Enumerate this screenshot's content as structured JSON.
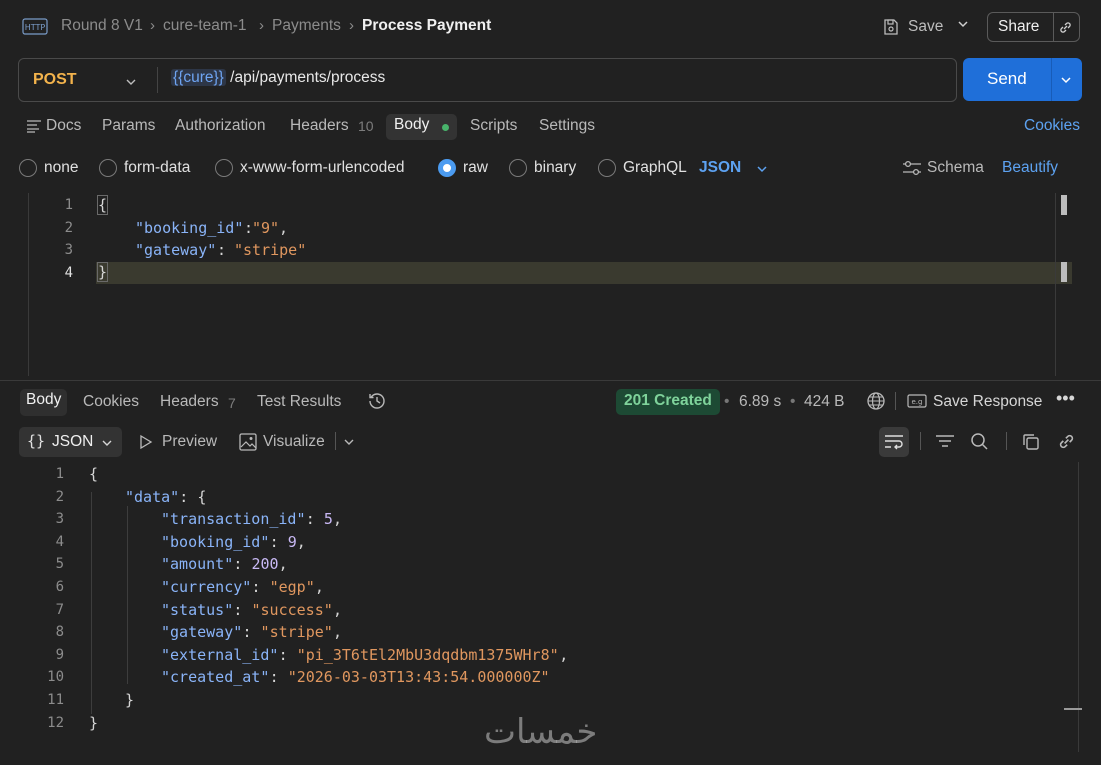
{
  "breadcrumb": {
    "items": [
      "Round 8 V1",
      "cure-team-1",
      "Payments"
    ],
    "current": "Process Payment"
  },
  "header": {
    "save_label": "Save",
    "share_label": "Share"
  },
  "request": {
    "method": "POST",
    "url_variable": "{{cure}}",
    "url_path": "/api/payments/process",
    "send_label": "Send"
  },
  "request_tabs": {
    "docs": "Docs",
    "params": "Params",
    "authorization": "Authorization",
    "headers": "Headers",
    "headers_count": "10",
    "body": "Body",
    "scripts": "Scripts",
    "settings": "Settings",
    "cookies": "Cookies"
  },
  "body_types": {
    "none": "none",
    "form_data": "form-data",
    "urlencoded": "x-www-form-urlencoded",
    "raw": "raw",
    "binary": "binary",
    "graphql": "GraphQL",
    "format": "JSON",
    "schema": "Schema",
    "beautify": "Beautify",
    "selected": "raw"
  },
  "request_body": {
    "line_numbers": [
      "1",
      "2",
      "3",
      "4"
    ],
    "open_brace": "{",
    "key1": "\"booking_id\"",
    "val1": "\"9\"",
    "key2": "\"gateway\"",
    "val2": "\"stripe\"",
    "close_brace": "}"
  },
  "response_tabs": {
    "body": "Body",
    "cookies": "Cookies",
    "headers": "Headers",
    "headers_count": "7",
    "test_results": "Test Results"
  },
  "response_status": {
    "status": "201 Created",
    "time": "6.89 s",
    "size": "424 B",
    "save_response": "Save Response"
  },
  "response_view": {
    "format": "JSON",
    "preview": "Preview",
    "visualize": "Visualize"
  },
  "response_body": {
    "line_numbers": [
      "1",
      "2",
      "3",
      "4",
      "5",
      "6",
      "7",
      "8",
      "9",
      "10",
      "11",
      "12"
    ],
    "open_brace": "{",
    "data_key": "\"data\"",
    "fields": [
      {
        "key": "\"transaction_id\"",
        "value": "5",
        "type": "num"
      },
      {
        "key": "\"booking_id\"",
        "value": "9",
        "type": "num"
      },
      {
        "key": "\"amount\"",
        "value": "200",
        "type": "num"
      },
      {
        "key": "\"currency\"",
        "value": "\"egp\"",
        "type": "str"
      },
      {
        "key": "\"status\"",
        "value": "\"success\"",
        "type": "str"
      },
      {
        "key": "\"gateway\"",
        "value": "\"stripe\"",
        "type": "str"
      },
      {
        "key": "\"external_id\"",
        "value": "\"pi_3T6tEl2MbU3dqdbm1375WHr8\"",
        "type": "str"
      },
      {
        "key": "\"created_at\"",
        "value": "\"2026-03-03T13:43:54.000000Z\"",
        "type": "str"
      }
    ],
    "inner_close": "}",
    "close_brace": "}"
  },
  "watermark": "خمسات"
}
